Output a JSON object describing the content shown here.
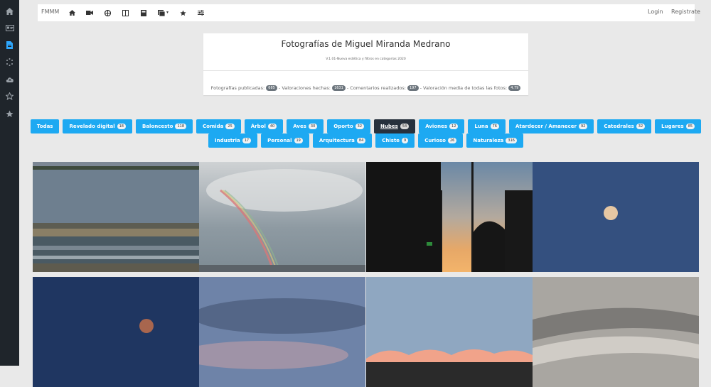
{
  "topbar": {
    "brand": "FMMM",
    "login": "Login",
    "register": "Registrate"
  },
  "header": {
    "title": "Fotografías de Miguel Miranda Medrano",
    "subtitle": "V.1.01-Nueva estética y filtros en categorías 2020",
    "stats": {
      "published_label": "Fotografías publicadas:",
      "published_count": "685",
      "ratings_label": "- Valoraciones hechas:",
      "ratings_count": "1631",
      "comments_label": "- Comentarios realizados:",
      "comments_count": "197",
      "avg_label": "- Valoración media de todas las fotos:",
      "avg_value": "4.79"
    }
  },
  "categories": {
    "row1": [
      {
        "label": "Todas",
        "count": ""
      },
      {
        "label": "Revelado digital",
        "count": "18"
      },
      {
        "label": "Baloncesto",
        "count": "118"
      },
      {
        "label": "Comida",
        "count": "25"
      },
      {
        "label": "Árbol",
        "count": "40"
      },
      {
        "label": "Aves",
        "count": "30"
      },
      {
        "label": "Oporto",
        "count": "32"
      },
      {
        "label": "Nubes",
        "count": "54",
        "active": true
      },
      {
        "label": "Aviones",
        "count": "12"
      },
      {
        "label": "Luna",
        "count": "76"
      },
      {
        "label": "Atardecer / Amanecer",
        "count": "92"
      },
      {
        "label": "Catedrales",
        "count": "32"
      },
      {
        "label": "Lugares",
        "count": "85"
      }
    ],
    "row2": [
      {
        "label": "Industria",
        "count": "17"
      },
      {
        "label": "Personal",
        "count": "19"
      },
      {
        "label": "Arquitectura",
        "count": "84"
      },
      {
        "label": "Chiste",
        "count": "9"
      },
      {
        "label": "Curioso",
        "count": "26"
      },
      {
        "label": "Naturaleza",
        "count": "316"
      }
    ]
  }
}
